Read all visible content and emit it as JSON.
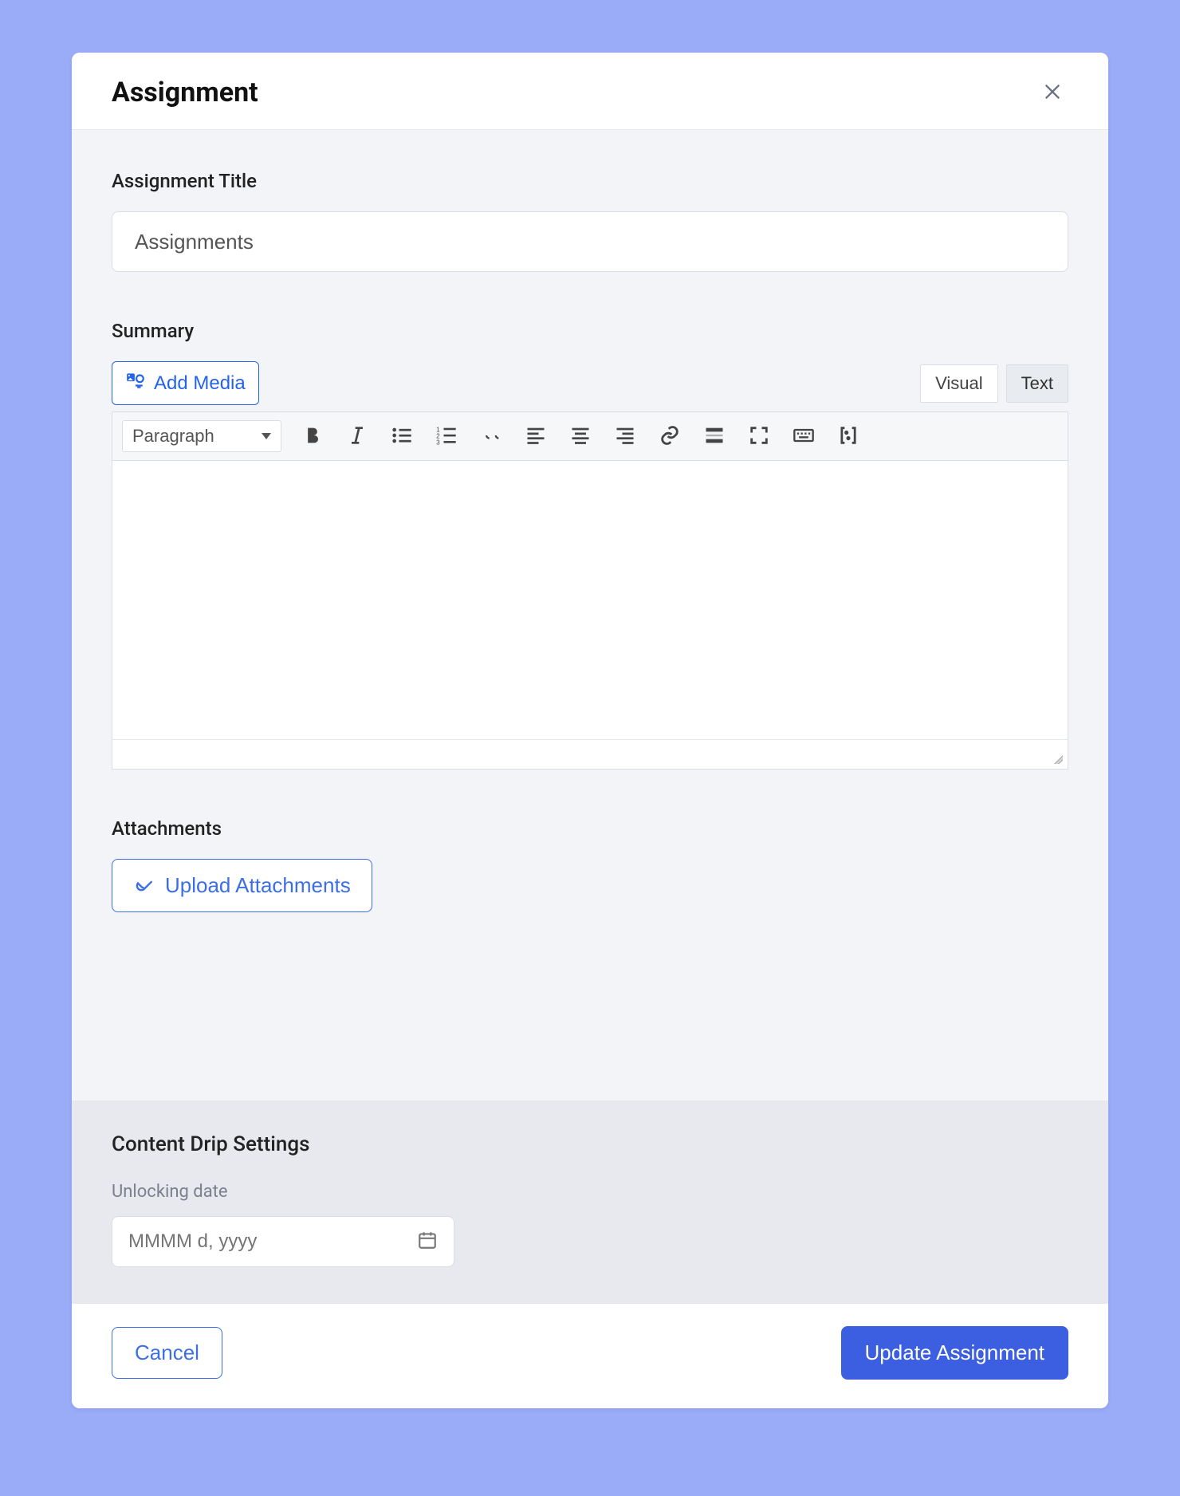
{
  "modal": {
    "title": "Assignment"
  },
  "fields": {
    "title_label": "Assignment Title",
    "title_value": "Assignments",
    "summary_label": "Summary",
    "attachments_label": "Attachments"
  },
  "editor": {
    "add_media_label": "Add Media",
    "tabs": {
      "visual": "Visual",
      "text": "Text",
      "active": "text"
    },
    "format_select": "Paragraph",
    "content": ""
  },
  "attachments": {
    "upload_label": "Upload Attachments"
  },
  "drip": {
    "section_title": "Content Drip Settings",
    "unlocking_label": "Unlocking date",
    "date_placeholder": "MMMM d, yyyy",
    "date_value": ""
  },
  "footer": {
    "cancel_label": "Cancel",
    "primary_label": "Update Assignment"
  },
  "colors": {
    "page_bg": "#9aabf7",
    "primary": "#3b5fe0",
    "primary_outline": "#3b6ee7"
  }
}
